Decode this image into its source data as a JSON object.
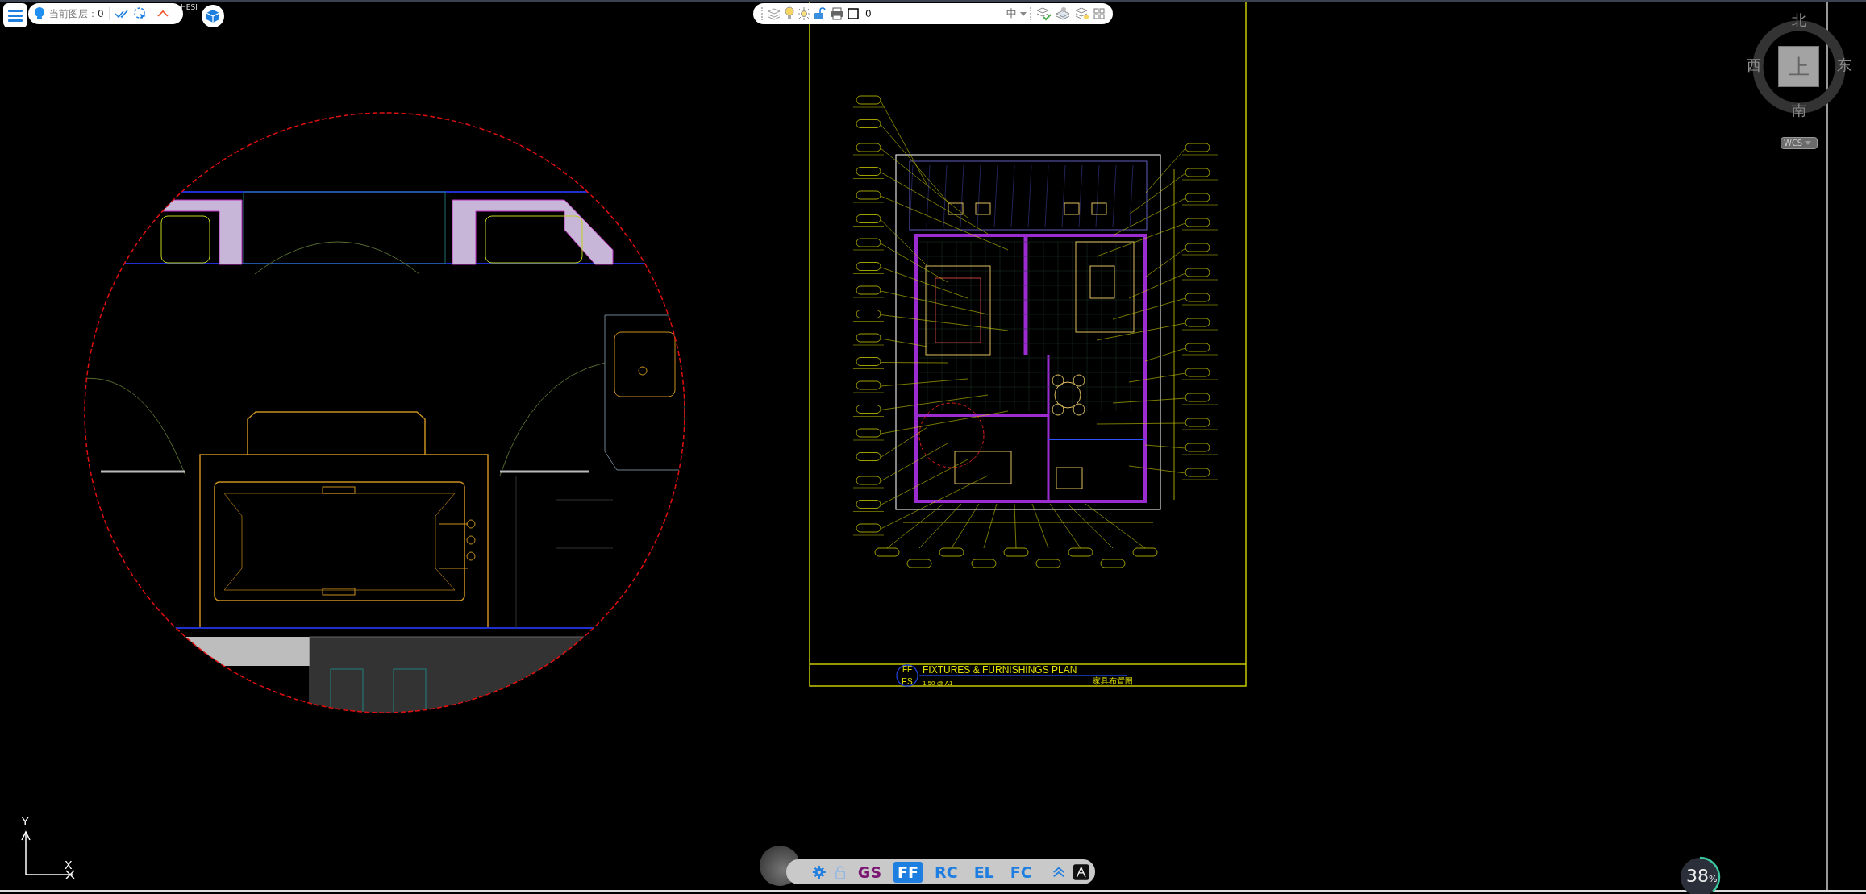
{
  "top_left_toolbar": {
    "current_layer_label": "当前图层：",
    "current_layer_value": "0",
    "user_label": "HESI"
  },
  "layer_toolbar": {
    "layer_name": "0",
    "linetype": "中"
  },
  "drawing": {
    "code_top": "FF",
    "code_bottom": "ES",
    "title": "FIXTURES & FURNISHINGS PLAN",
    "scale": "1:50 @ A1",
    "title_cn": "家具布置图"
  },
  "view_cube": {
    "north": "北",
    "west": "西",
    "east": "东",
    "south": "南",
    "face": "上",
    "coordinate_system": "WCS"
  },
  "ucs": {
    "y_label": "Y",
    "x_label": "X"
  },
  "layout_tabs": [
    {
      "label": "GS",
      "selected": false,
      "color": "#7b1673"
    },
    {
      "label": "FF",
      "selected": true,
      "color": "#1f7fe0"
    },
    {
      "label": "RC",
      "selected": false,
      "color": "#1f7fe0"
    },
    {
      "label": "EL",
      "selected": false,
      "color": "#1f7fe0"
    },
    {
      "label": "FC",
      "selected": false,
      "color": "#1f7fe0"
    }
  ],
  "zoom_badge": {
    "reading": "38",
    "unit": "%",
    "level": 0.38
  }
}
